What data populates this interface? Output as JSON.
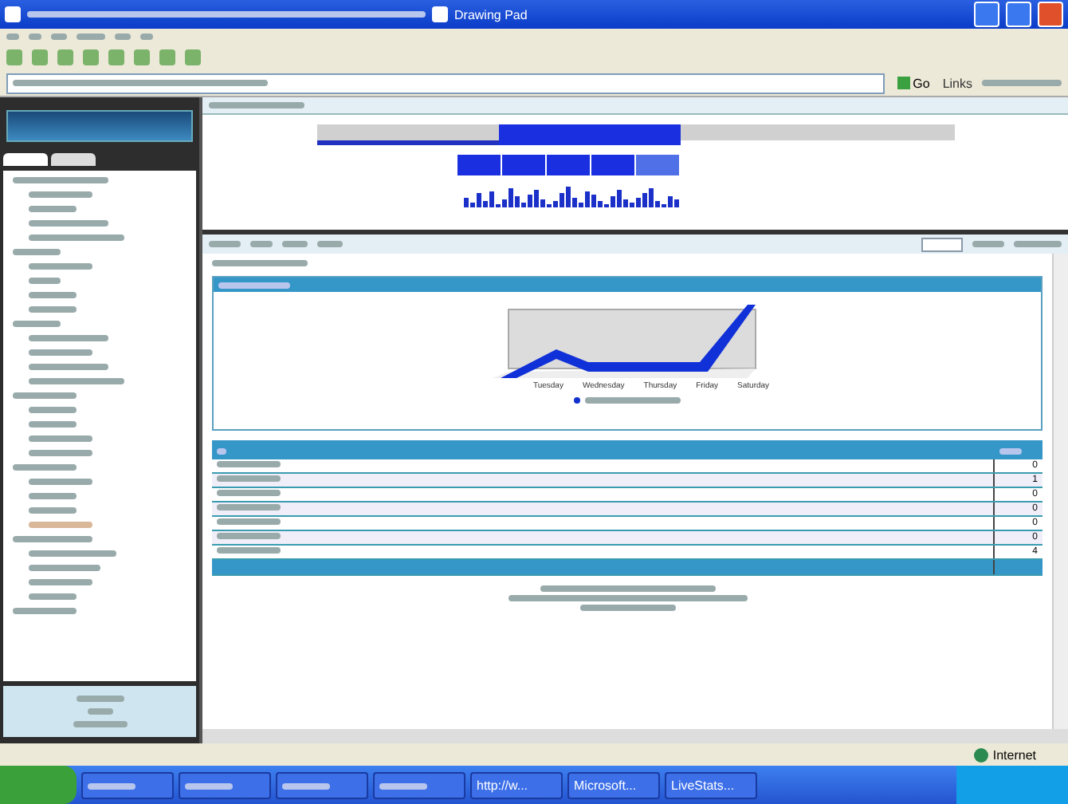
{
  "title_bar": {
    "app_title": "Drawing Pad"
  },
  "address_bar": {
    "go": "Go",
    "links": "Links"
  },
  "chart_panel": {
    "x_labels": [
      "Tuesday",
      "Wednesday",
      "Thursday",
      "Friday",
      "Saturday"
    ]
  },
  "table": {
    "rows": [
      {
        "value": "0"
      },
      {
        "value": "1"
      },
      {
        "value": "0"
      },
      {
        "value": "0"
      },
      {
        "value": "0"
      },
      {
        "value": "0"
      },
      {
        "value": "4"
      }
    ]
  },
  "status_bar": {
    "zone": "Internet"
  },
  "taskbar": {
    "items": [
      {
        "label": "http://w..."
      },
      {
        "label": "Microsoft..."
      },
      {
        "label": "LiveStats..."
      }
    ]
  }
}
